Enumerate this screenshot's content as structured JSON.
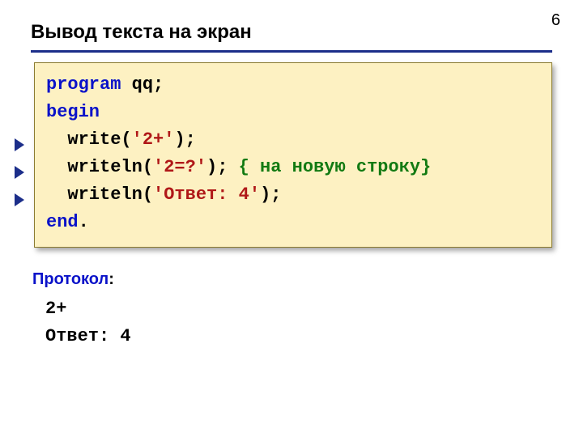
{
  "page_number": "6",
  "title": "Вывод текста на экран",
  "code": {
    "l1_kw1": "program",
    "l1_name": " qq",
    "l1_semi": ";",
    "l2_begin": "begin",
    "l3_indent": "  ",
    "l3_fn": "write",
    "l3_open": "(",
    "l3_str": "'2+'",
    "l3_close": ");",
    "l4_indent": "  ",
    "l4_fn": "write",
    "l4_ln": "ln",
    "l4_open": "(",
    "l4_str": "'2=?'",
    "l4_close": "); ",
    "l4_cmt": "{ на новую строку}",
    "l5_indent": "  ",
    "l5_fn": "write",
    "l5_ln": "ln",
    "l5_open": "(",
    "l5_str": "'Ответ: 4'",
    "l5_close": ");",
    "l6_end": "end",
    "l6_dot": "."
  },
  "protocol": {
    "label": "Протокол",
    "colon": ":",
    "line1": "2+",
    "line2": "Ответ: 4"
  }
}
